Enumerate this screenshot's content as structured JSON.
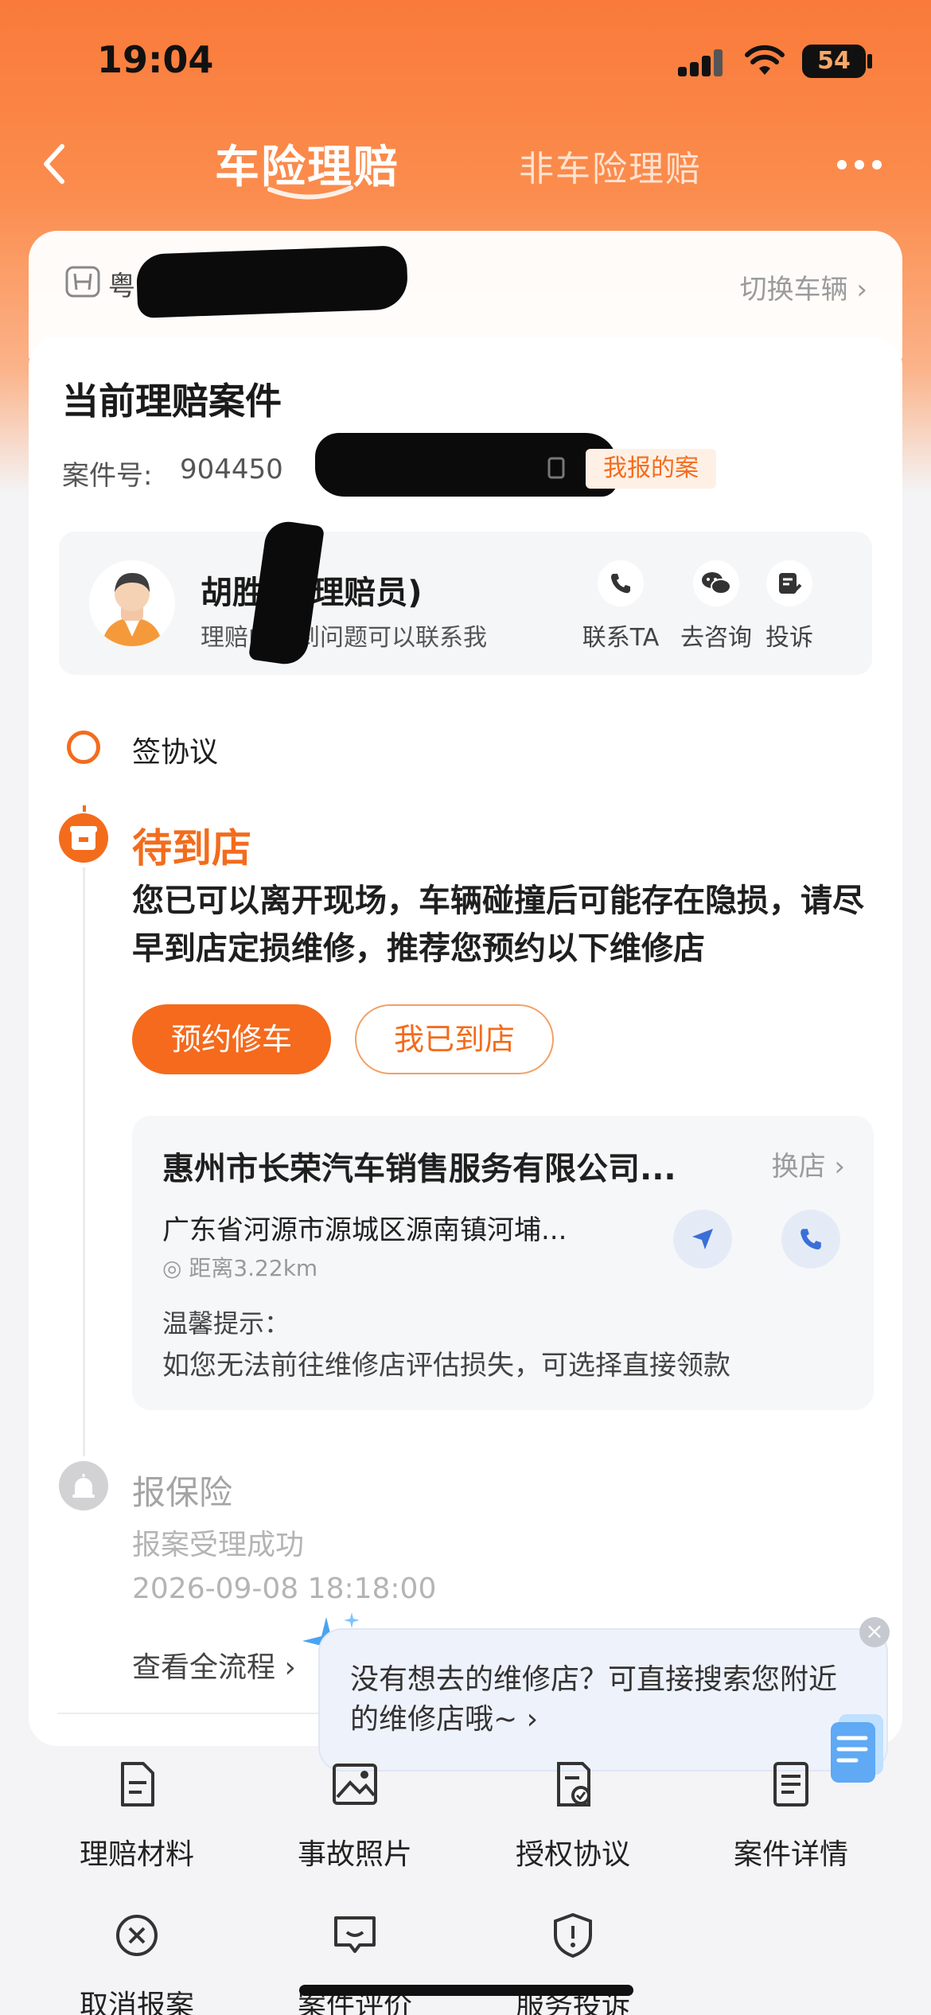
{
  "status_bar": {
    "time": "19:04",
    "battery": "54"
  },
  "nav": {
    "tab_active": "车险理赔",
    "tab_inactive": "非车险理赔"
  },
  "vehicle": {
    "plate": "粤P",
    "switch_label": "切换车辆"
  },
  "case": {
    "title": "当前理赔案件",
    "number_label": "案件号:",
    "number_value": "904450",
    "reported_badge": "我报的案"
  },
  "adjuster": {
    "name": "胡胜",
    "role": "(理赔员)",
    "desc": "理赔中遇到问题可以联系我",
    "actions": [
      {
        "label": "联系TA",
        "icon": "phone-icon"
      },
      {
        "label": "去咨询",
        "icon": "wechat-icon"
      },
      {
        "label": "投诉",
        "icon": "complaint-icon"
      }
    ]
  },
  "timeline": {
    "step1": "签协议",
    "step2_title": "待到店",
    "step2_desc": "您已可以离开现场，车辆碰撞后可能存在隐损，请尽早到店定损维修，推荐您预约以下维修店",
    "btn_book": "预约修车",
    "btn_arrived": "我已到店",
    "step3_title": "报保险",
    "step3_sub": "报案受理成功",
    "step3_date": "2026-09-08 18:18:00",
    "view_all": "查看全流程"
  },
  "shop": {
    "name": "惠州市长荣汽车销售服务有限公司...",
    "change_label": "换店",
    "address": "广东省河源市源城区源南镇河埔...",
    "distance": "距离3.22km",
    "tip_label": "温馨提示：",
    "tip_body": "如您无法前往维修店评估损失，可选择直接领款"
  },
  "tooltip": {
    "text": "没有想去的维修店？可直接搜索您附近的维修店哦~"
  },
  "grid": [
    {
      "label": "理赔材料",
      "icon": "document-icon"
    },
    {
      "label": "事故照片",
      "icon": "photo-icon"
    },
    {
      "label": "授权协议",
      "icon": "agreement-icon"
    },
    {
      "label": "案件详情",
      "icon": "details-icon"
    },
    {
      "label": "取消报案",
      "icon": "cancel-icon"
    },
    {
      "label": "案件评价",
      "icon": "comment-icon"
    },
    {
      "label": "服务投诉",
      "icon": "alert-icon"
    }
  ],
  "colors": {
    "accent": "#f36c1c",
    "header": "#f97a3a"
  }
}
